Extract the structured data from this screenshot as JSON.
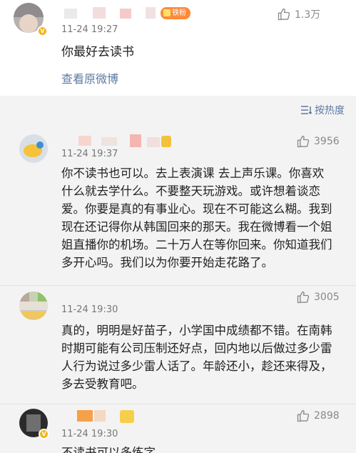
{
  "post": {
    "time": "11-24 19:27",
    "fan_badge": "铁粉",
    "like_count": "1.3万",
    "text": "你最好去读书",
    "view_original": "查看原微博"
  },
  "sort": {
    "label": "按热度"
  },
  "comments": [
    {
      "time": "11-24 19:37",
      "likes": "3956",
      "text": "你不读书也可以。去上表演课 去上声乐课。你喜欢什么就去学什么。不要整天玩游戏。或许想着谈恋爱。你要是真的有事业心。现在不可能这么糊。我到现在还记得你从韩国回来的那天。我在微博看一个姐姐直播你的机场。二十万人在等你回来。你知道我们多开心吗。我们以为你要开始走花路了。"
    },
    {
      "time": "11-24 19:30",
      "likes": "3005",
      "text": "真的，明明是好苗子，小学国中成绩都不错。在南韩时期可能有公司压制还好点，回内地以后做过多少雷人行为说过多少雷人话了。年龄还小，趁还来得及，多去受教育吧。"
    },
    {
      "time": "11-24 19:30",
      "likes": "2898",
      "text": "不读书可以多练字"
    }
  ],
  "colors": {
    "link": "#5d7aa3",
    "muted": "#888888",
    "badge_orange": "#ff8a3c",
    "verified_yellow": "#f4b41a",
    "comments_bg": "#f3f3f3"
  },
  "icons": [
    "thumbs-up-icon",
    "sort-icon",
    "verified-badge-icon"
  ]
}
